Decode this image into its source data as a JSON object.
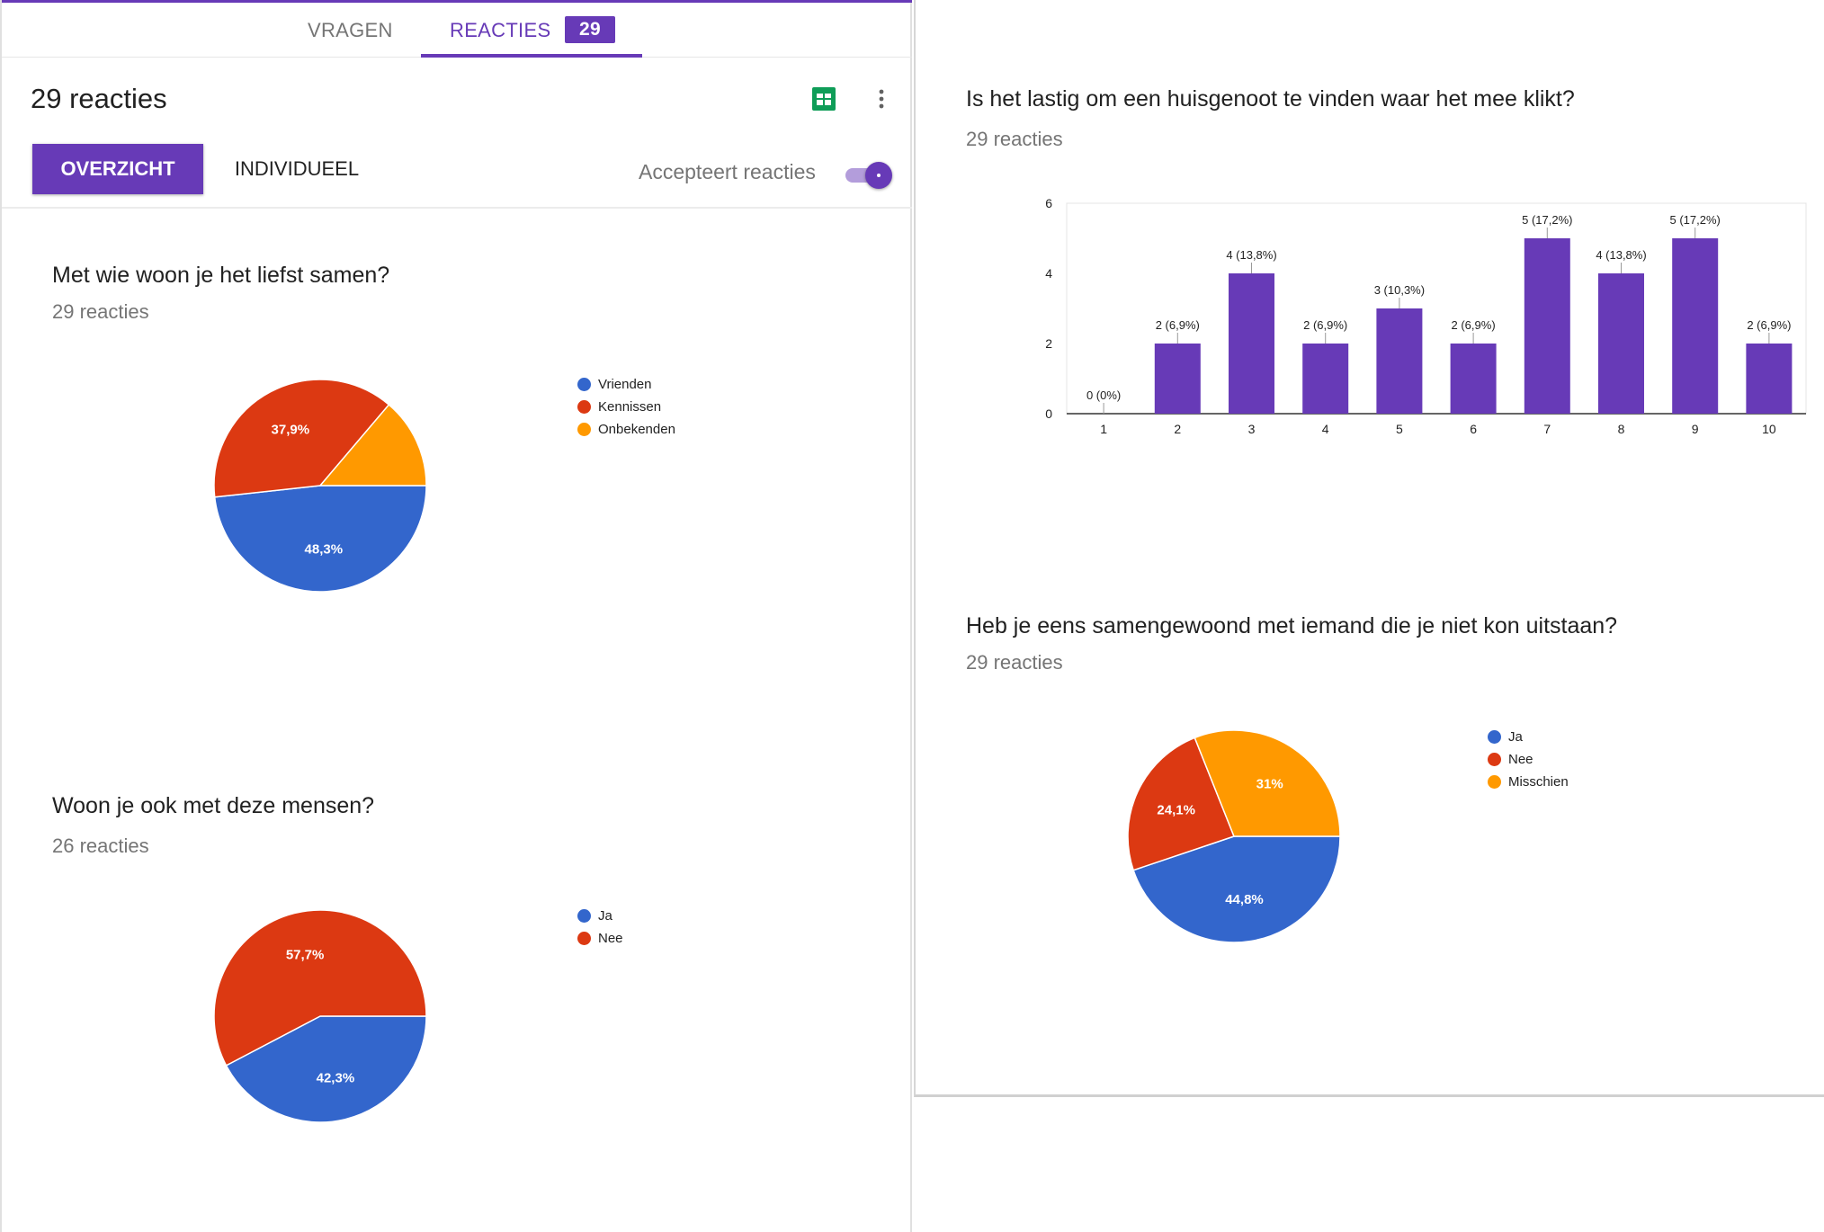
{
  "tabs": {
    "questions_label": "VRAGEN",
    "responses_label": "REACTIES",
    "responses_count": "29"
  },
  "header": {
    "title": "29 reacties",
    "sheets_icon": "google-sheets-icon",
    "more_icon": "more-vert-icon",
    "overview_label": "OVERZICHT",
    "individual_label": "INDIVIDUEEL",
    "accepting_label": "Accepteert reacties",
    "accepting_on": true
  },
  "colors": {
    "accent": "#673ab7",
    "blue": "#3366cc",
    "red": "#dc3912",
    "orange": "#ff9900",
    "bar": "#673ab7"
  },
  "questions": [
    {
      "title": "Met wie woon je het liefst samen?",
      "count": "29 reacties",
      "legend": [
        {
          "label": "Vrienden",
          "color": "#3366cc"
        },
        {
          "label": "Kennissen",
          "color": "#dc3912"
        },
        {
          "label": "Onbekenden",
          "color": "#ff9900"
        }
      ]
    },
    {
      "title": "Woon je ook met deze mensen?",
      "count": "26 reacties",
      "legend": [
        {
          "label": "Ja",
          "color": "#3366cc"
        },
        {
          "label": "Nee",
          "color": "#dc3912"
        }
      ]
    },
    {
      "title": "Is het lastig om een huisgenoot te vinden waar het mee klikt?",
      "count": "29 reacties"
    },
    {
      "title": "Heb je eens samengewoond met iemand die je niet kon uitstaan?",
      "count": "29 reacties",
      "legend": [
        {
          "label": "Ja",
          "color": "#3366cc"
        },
        {
          "label": "Nee",
          "color": "#dc3912"
        },
        {
          "label": "Misschien",
          "color": "#ff9900"
        }
      ]
    }
  ],
  "chart_data": [
    {
      "type": "pie",
      "categories": [
        "Vrienden",
        "Kennissen",
        "Onbekenden"
      ],
      "values": [
        14,
        11,
        4
      ],
      "labels": [
        "48,3%",
        "37,9%",
        ""
      ],
      "colors": [
        "#3366cc",
        "#dc3912",
        "#ff9900"
      ],
      "legend": "right"
    },
    {
      "type": "pie",
      "categories": [
        "Ja",
        "Nee"
      ],
      "values": [
        11,
        15
      ],
      "labels": [
        "42,3%",
        "57,7%"
      ],
      "colors": [
        "#3366cc",
        "#dc3912"
      ],
      "legend": "right"
    },
    {
      "type": "bar",
      "categories": [
        "1",
        "2",
        "3",
        "4",
        "5",
        "6",
        "7",
        "8",
        "9",
        "10"
      ],
      "values": [
        0,
        2,
        4,
        2,
        3,
        2,
        5,
        4,
        5,
        2
      ],
      "labels": [
        "0 (0%)",
        "2 (6,9%)",
        "4 (13,8%)",
        "2 (6,9%)",
        "3 (10,3%)",
        "2 (6,9%)",
        "5 (17,2%)",
        "4 (13,8%)",
        "5 (17,2%)",
        "2 (6,9%)"
      ],
      "y_ticks": [
        "0",
        "2",
        "4",
        "6"
      ],
      "ylim": [
        0,
        6
      ],
      "grid": false
    },
    {
      "type": "pie",
      "categories": [
        "Ja",
        "Nee",
        "Misschien"
      ],
      "values": [
        13,
        7,
        9
      ],
      "labels": [
        "44,8%",
        "24,1%",
        "31%"
      ],
      "colors": [
        "#3366cc",
        "#dc3912",
        "#ff9900"
      ],
      "legend": "right"
    }
  ]
}
